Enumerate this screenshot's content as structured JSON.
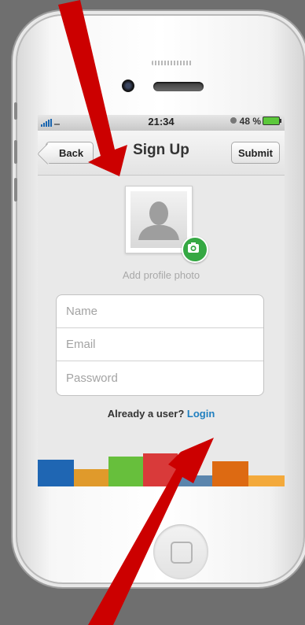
{
  "status_bar": {
    "time": "21:34",
    "battery": "48 %"
  },
  "nav": {
    "back_label": "Back",
    "title": "Sign Up",
    "submit_label": "Submit"
  },
  "profile": {
    "add_photo_label": "Add profile photo"
  },
  "form": {
    "name_placeholder": "Name",
    "email_placeholder": "Email",
    "password_placeholder": "Password"
  },
  "login": {
    "prompt": "Already a user?",
    "link": "Login"
  },
  "footer_blocks": [
    "#1f66b3",
    "#e09a2b",
    "#67bf3c",
    "#d93a3a",
    "#5b85ad",
    "#dd6a12",
    "#f3a93b"
  ],
  "arrow_color": "#cc0000"
}
